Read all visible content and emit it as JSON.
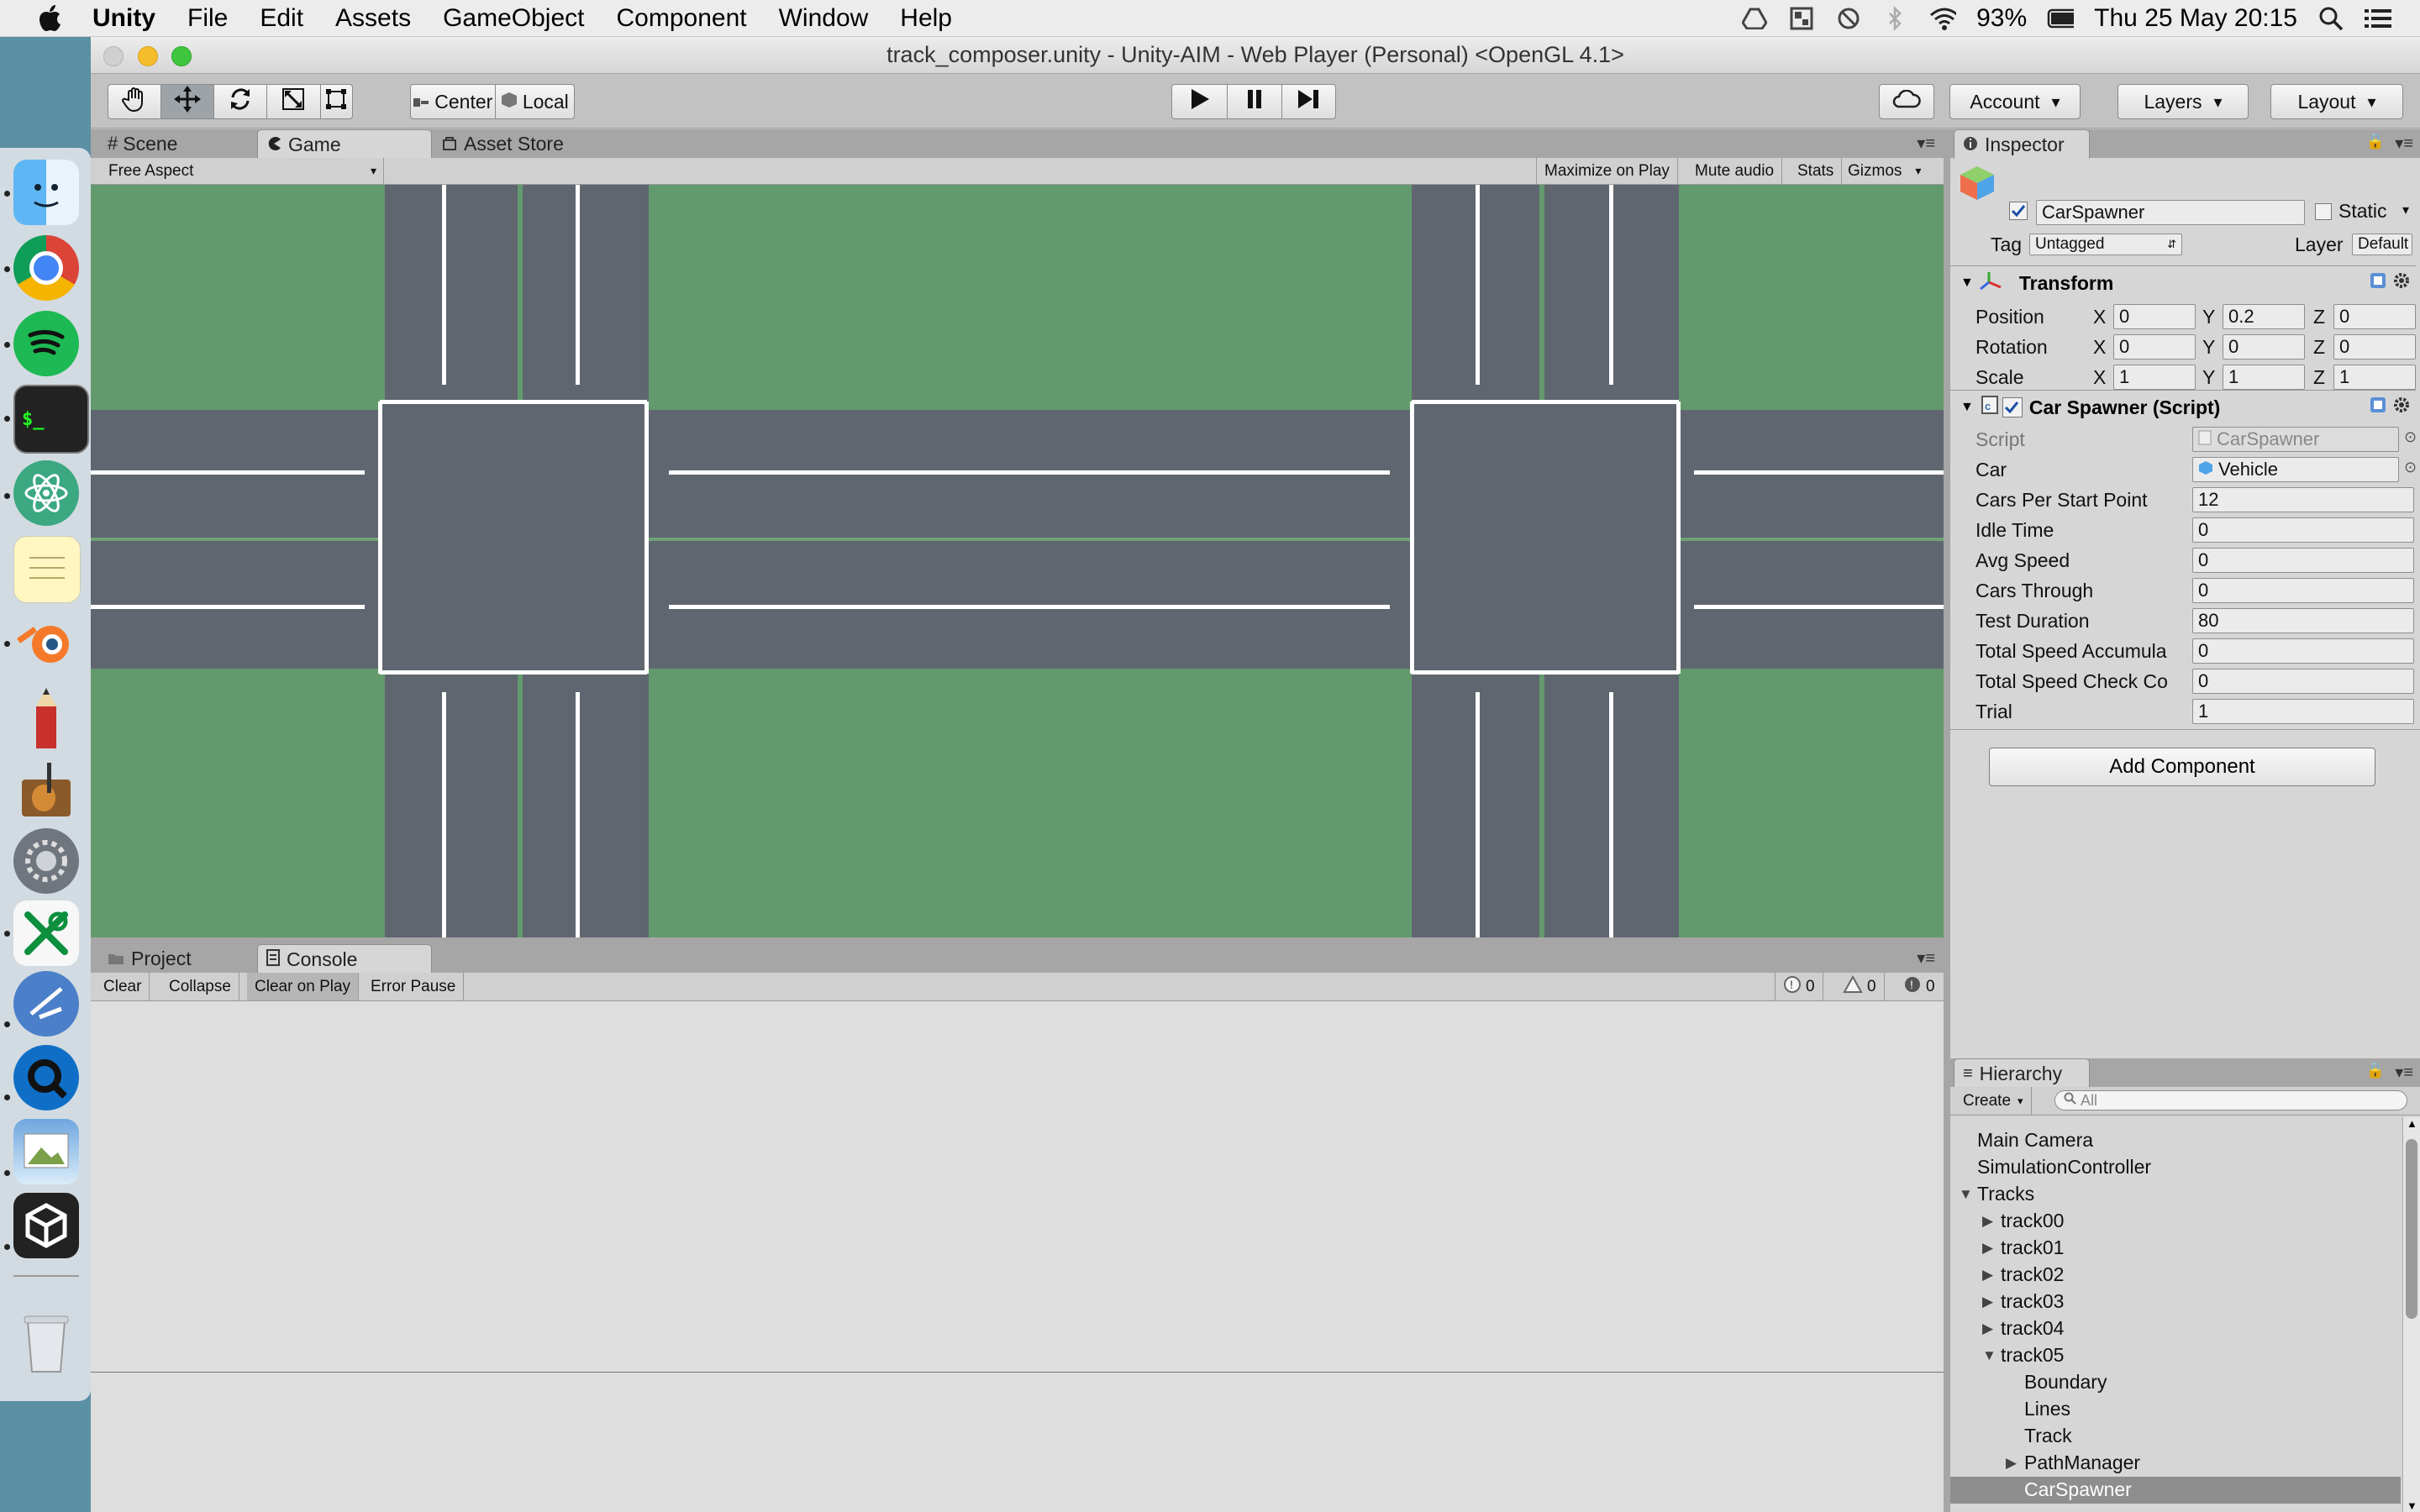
{
  "menubar": {
    "app": "Unity",
    "items": [
      "File",
      "Edit",
      "Assets",
      "GameObject",
      "Component",
      "Window",
      "Help"
    ],
    "battery": "93%",
    "clock": "Thu 25 May  20:15"
  },
  "window": {
    "title": "track_composer.unity - Unity-AIM - Web Player (Personal) <OpenGL 4.1>"
  },
  "toolbar": {
    "pivot_mode": "Center",
    "pivot_space": "Local",
    "account": "Account",
    "layers": "Layers",
    "layout": "Layout"
  },
  "tabs": {
    "scene": "Scene",
    "game": "Game",
    "asset_store": "Asset Store",
    "inspector": "Inspector",
    "project": "Project",
    "console": "Console",
    "hierarchy": "Hierarchy"
  },
  "game_bar": {
    "aspect": "Free Aspect",
    "maximize": "Maximize on Play",
    "mute": "Mute audio",
    "stats": "Stats",
    "gizmos": "Gizmos"
  },
  "console_bar": {
    "clear": "Clear",
    "collapse": "Collapse",
    "clear_on_play": "Clear on Play",
    "error_pause": "Error Pause",
    "info_count": "0",
    "warn_count": "0",
    "error_count": "0"
  },
  "inspector": {
    "object_name": "CarSpawner",
    "static_label": "Static",
    "tag_label": "Tag",
    "tag_value": "Untagged",
    "layer_label": "Layer",
    "layer_value": "Default",
    "transform": {
      "title": "Transform",
      "rows": [
        {
          "label": "Position",
          "x": "0",
          "y": "0.2",
          "z": "0"
        },
        {
          "label": "Rotation",
          "x": "0",
          "y": "0",
          "z": "0"
        },
        {
          "label": "Scale",
          "x": "1",
          "y": "1",
          "z": "1"
        }
      ],
      "axis_x": "X",
      "axis_y": "Y",
      "axis_z": "Z"
    },
    "script_component": {
      "title": "Car Spawner (Script)",
      "fields": [
        {
          "label": "Script",
          "value": "CarSpawner"
        },
        {
          "label": "Car",
          "value": "Vehicle"
        },
        {
          "label": "Cars Per Start Point",
          "value": "12"
        },
        {
          "label": "Idle Time",
          "value": "0"
        },
        {
          "label": "Avg Speed",
          "value": "0"
        },
        {
          "label": "Cars Through",
          "value": "0"
        },
        {
          "label": "Test Duration",
          "value": "80"
        },
        {
          "label": "Total Speed Accumula",
          "value": "0"
        },
        {
          "label": "Total Speed Check Co",
          "value": "0"
        },
        {
          "label": "Trial",
          "value": "1"
        }
      ]
    },
    "add_component": "Add Component"
  },
  "hierarchy": {
    "create": "Create",
    "search_placeholder": "All",
    "items": [
      {
        "label": "Main Camera",
        "depth": 0,
        "arrow": "none"
      },
      {
        "label": "SimulationController",
        "depth": 0,
        "arrow": "none"
      },
      {
        "label": "Tracks",
        "depth": 0,
        "arrow": "open"
      },
      {
        "label": "track00",
        "depth": 1,
        "arrow": "closed"
      },
      {
        "label": "track01",
        "depth": 1,
        "arrow": "closed"
      },
      {
        "label": "track02",
        "depth": 1,
        "arrow": "closed"
      },
      {
        "label": "track03",
        "depth": 1,
        "arrow": "closed"
      },
      {
        "label": "track04",
        "depth": 1,
        "arrow": "closed"
      },
      {
        "label": "track05",
        "depth": 1,
        "arrow": "open"
      },
      {
        "label": "Boundary",
        "depth": 2,
        "arrow": "none"
      },
      {
        "label": "Lines",
        "depth": 2,
        "arrow": "none"
      },
      {
        "label": "Track",
        "depth": 2,
        "arrow": "none"
      },
      {
        "label": "PathManager",
        "depth": 2,
        "arrow": "closed"
      },
      {
        "label": "CarSpawner",
        "depth": 2,
        "arrow": "none",
        "selected": true
      }
    ]
  },
  "colors": {
    "grass": "#639a6d",
    "road": "#5f6670",
    "editor_bg": "#c2c2c2",
    "selection": "#8e8e8e"
  }
}
